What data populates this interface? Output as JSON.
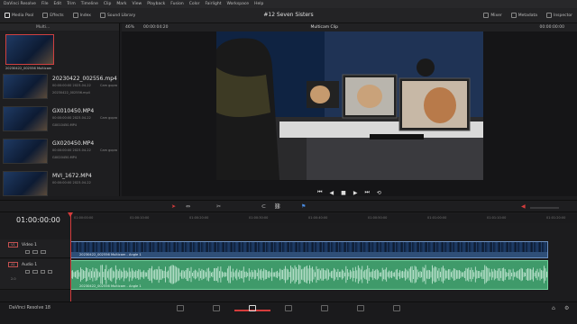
{
  "menubar": {
    "items": [
      "DaVinci Resolve",
      "File",
      "Edit",
      "Trim",
      "Timeline",
      "Clip",
      "Mark",
      "View",
      "Playback",
      "Fusion",
      "Color",
      "Fairlight",
      "Workspace",
      "Help"
    ]
  },
  "toolbar": {
    "media_pool": "Media Pool",
    "effects": "Effects",
    "index": "Index",
    "sound_library": "Sound Library",
    "project_title": "#12 Seven Sisters",
    "mixer": "Mixer",
    "metadata": "Metadata",
    "inspector": "Inspector"
  },
  "media_pool": {
    "header": "Multi...",
    "first_item_caption": "20230422_002556 Multicam",
    "items": [
      {
        "name": "20230422_002556.mp4",
        "meta": "00:00:00:00     2023-04-22",
        "meta2": "20230422_002556.mp4",
        "right": "Cam gopro"
      },
      {
        "name": "GX010450.MP4",
        "meta": "00:00:00:00     2023-04-22",
        "meta2": "GX010450.MP4",
        "right": "Cam gopro"
      },
      {
        "name": "GX020450.MP4",
        "meta": "00:00:00:00     2023-04-22",
        "meta2": "GX020450.MP4",
        "right": "Cam gopro"
      },
      {
        "name": "MVI_1672.MP4",
        "meta": "00:00:00:00     2023-04-22",
        "meta2": "",
        "right": ""
      }
    ]
  },
  "viewer": {
    "zoom": "46%",
    "source_timecode": "00:00:04:20",
    "clip_name": "Multicam Clip",
    "right_timecode": "00:00:00:00"
  },
  "timeline": {
    "timecode": "01:00:00:00",
    "ruler_ticks": [
      "01:00:00:00",
      "01:00:10:00",
      "01:00:20:00",
      "01:00:30:00",
      "01:00:40:00",
      "01:00:50:00",
      "01:01:00:00",
      "01:01:10:00",
      "01:01:20:00"
    ],
    "tracks": [
      {
        "tag": "V1",
        "name": "Video 1",
        "clip_label": "20230422_002556 Multicam - Angle 1"
      },
      {
        "tag": "A1",
        "name": "Audio 1",
        "channels": "2.0",
        "clip_label": "20230422_002556 Multicam - Angle 1"
      }
    ]
  },
  "pagebar": {
    "app_name": "DaVinci Resolve 18",
    "pages": [
      "media-icon",
      "cut-icon",
      "edit-icon",
      "fusion-icon",
      "color-icon",
      "fairlight-icon",
      "deliver-icon"
    ]
  },
  "colors": {
    "playhead": "#d43c3c",
    "video_clip": "#2f4f78",
    "audio_clip": "#3f9a6a"
  }
}
